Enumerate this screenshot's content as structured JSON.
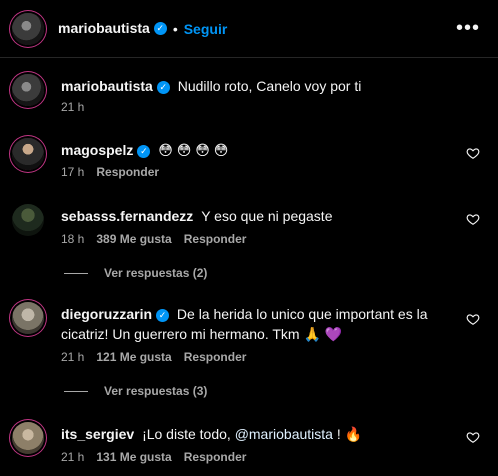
{
  "header": {
    "username": "mariobautista",
    "dot": "•",
    "follow_label": "Seguir",
    "more": "•••"
  },
  "caption": {
    "username": "mariobautista",
    "text": "Nudillo roto, Canelo voy por ti",
    "time": "21 h"
  },
  "comments": [
    {
      "username": "magospelz",
      "text": "😳 😳 😳 😳",
      "time": "17 h",
      "likes": "",
      "reply_label": "Responder"
    },
    {
      "username": "sebasss.fernandezz",
      "text": "Y eso que ni pegaste",
      "time": "18 h",
      "likes": "389 Me gusta",
      "reply_label": "Responder",
      "view_replies": "Ver respuestas (2)"
    },
    {
      "username": "diegoruzzarin",
      "text": "De la herida lo unico que important es la cicatriz! Un guerrero mi hermano. Tkm 🙏 💜",
      "time": "21 h",
      "likes": "121 Me gusta",
      "reply_label": "Responder",
      "view_replies": "Ver respuestas (3)"
    },
    {
      "username": "its_sergiev",
      "text_before": "¡Lo diste todo, ",
      "mention": "@mariobautista",
      "text_after": " ! 🔥",
      "time": "21 h",
      "likes": "131 Me gusta",
      "reply_label": "Responder"
    }
  ]
}
